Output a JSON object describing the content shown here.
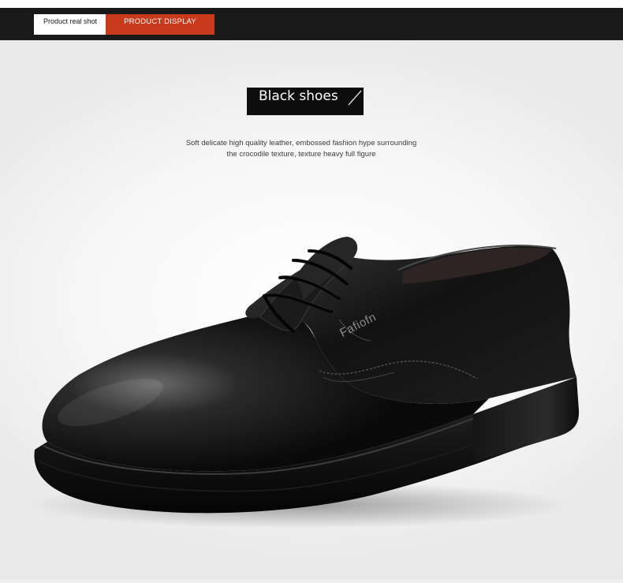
{
  "tabs": {
    "real_shot": "Product real shot",
    "display": "PRODUCT DISPLAY"
  },
  "hero": {
    "title": "Black shoes",
    "description_line1": "Soft delicate high quality leather, embossed fashion hype surrounding",
    "description_line2": "the crocodile texture, texture heavy full figure"
  },
  "product": {
    "brand_mark": "Fafiofn",
    "image": "black-leather-derby-shoe"
  },
  "colors": {
    "topbar": "#1a1a1a",
    "accent": "#c9391c",
    "title_box": "#0d0d0d"
  }
}
